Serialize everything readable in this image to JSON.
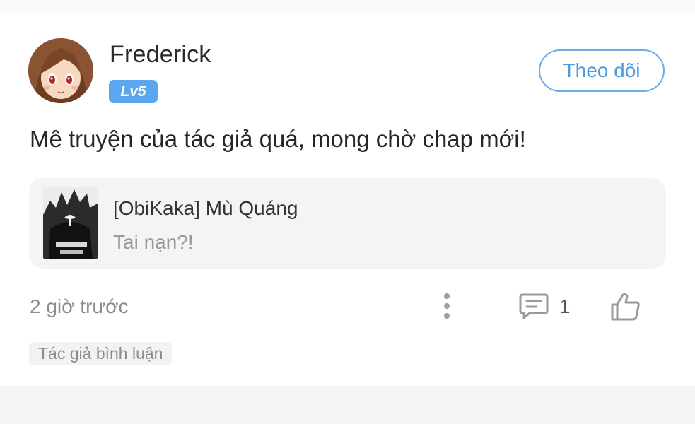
{
  "user": {
    "name": "Frederick",
    "level": "Lv5",
    "avatar_icon": "anime-girl-avatar",
    "follow_label": "Theo dõi"
  },
  "comment": {
    "text": "Mê truyện của tác giả quá, mong chờ chap mới!"
  },
  "quote": {
    "thumbnail_icon": "manga-cover-thumbnail",
    "title": "[ObiKaka] Mù Quáng",
    "text": "Tai nạn?!"
  },
  "footer": {
    "time": "2 giờ trước",
    "reply_count": "1",
    "more_icon": "more-vertical-icon",
    "reply_icon": "comment-icon",
    "like_icon": "thumbs-up-icon",
    "tag": "Tác giả bình luận"
  },
  "colors": {
    "accent": "#5aa7f0",
    "follow_border": "#6aaee9",
    "muted_text": "#8c8c8c"
  }
}
